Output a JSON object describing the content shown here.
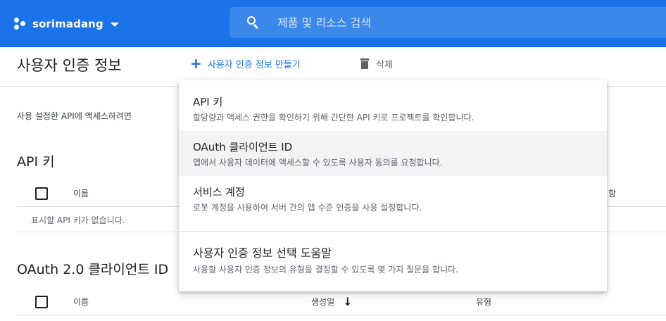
{
  "topbar": {
    "project_name": "sorimadang",
    "search_placeholder": "제품 및 리소스 검색",
    "color": "#1a73e8"
  },
  "toolbar": {
    "title": "사용자 인증 정보",
    "create_label": "사용자 인증 정보 만들기",
    "delete_label": "삭제"
  },
  "main": {
    "intro_text": "사용 설정한 API에 액세스하려면",
    "api_keys": {
      "heading": "API 키",
      "columns": {
        "name": "이름",
        "right": "항"
      },
      "empty_message": "표시할 API 키가 없습니다."
    },
    "oauth": {
      "heading": "OAuth 2.0 클라이언트 ID",
      "columns": {
        "name": "이름",
        "created": "생성일",
        "type": "유형"
      }
    }
  },
  "menu": {
    "items": [
      {
        "title": "API 키",
        "desc": "할당량과 액세스 권한을 확인하기 위해 간단한 API 키로 프로젝트를 확인합니다."
      },
      {
        "title": "OAuth 클라이언트 ID",
        "desc": "앱에서 사용자 데이터에 액세스할 수 있도록 사용자 동의를 요청합니다."
      },
      {
        "title": "서비스 계정",
        "desc": "로봇 계정을 사용하여 서버 간의 앱 수준 인증을 사용 설정합니다."
      },
      {
        "title": "사용자 인증 정보 선택 도움말",
        "desc": "사용할 사용자 인증 정보의 유형을 결정할 수 있도록 몇 가지 질문을 합니다."
      }
    ]
  },
  "icons": {
    "project": "project-dots-icon",
    "caret": "chevron-down-icon",
    "search": "search-icon",
    "create": "plus-icon",
    "delete": "trash-icon",
    "sort": "arrow-down-icon"
  }
}
